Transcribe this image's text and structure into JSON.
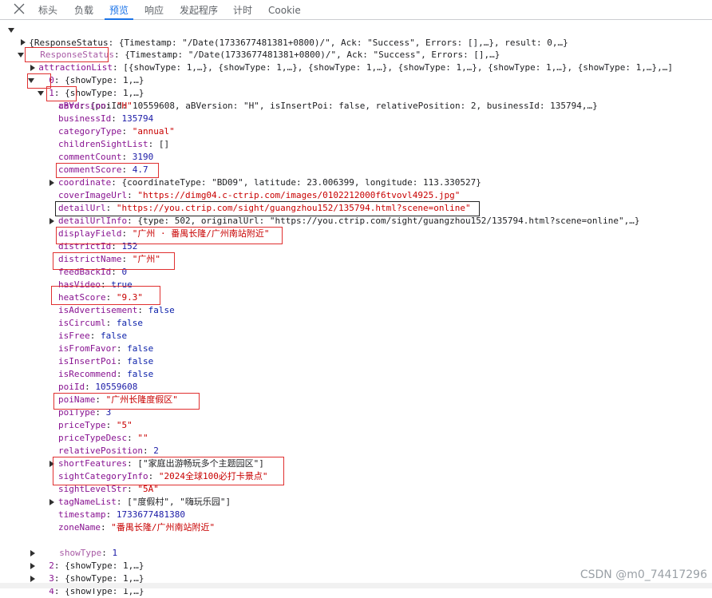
{
  "tabs": [
    {
      "label": "标头",
      "active": false
    },
    {
      "label": "负载",
      "active": false
    },
    {
      "label": "预览",
      "active": true
    },
    {
      "label": "响应",
      "active": false
    },
    {
      "label": "发起程序",
      "active": false
    },
    {
      "label": "计时",
      "active": false
    },
    {
      "label": "Cookie",
      "active": false
    }
  ],
  "tree": {
    "root_summary": "{ResponseStatus: {Timestamp: \"/Date(1733677481381+0800)/\", Ack: \"Success\", Errors: [],…}, result: 0,…}",
    "response_status": {
      "key": "ResponseStatus",
      "summary": "{Timestamp: \"/Date(1733677481381+0800)/\", Ack: \"Success\", Errors: [],…}"
    },
    "attraction_list": {
      "key": "attractionList",
      "summary": "[{showType: 1,…}, {showType: 1,…}, {showType: 1,…}, {showType: 1,…}, {showType: 1,…}, {showType: 1,…},…]"
    },
    "item0": {
      "key": "0",
      "summary": "{showType: 1,…}"
    },
    "item1": {
      "key": "1",
      "summary": "{showType: 1,…}"
    },
    "card": {
      "key": "card",
      "summary": "{poiId: 10559608, aBVersion: \"H\", isInsertPoi: false, relativePosition: 2, businessId: 135794,…}"
    },
    "fields": [
      {
        "key": "aBVersion",
        "value": "\"H\"",
        "type": "str"
      },
      {
        "key": "businessId",
        "value": "135794",
        "type": "num"
      },
      {
        "key": "categoryType",
        "value": "\"annual\"",
        "type": "str"
      },
      {
        "key": "childrenSightList",
        "value": "[]",
        "type": "plain"
      },
      {
        "key": "commentCount",
        "value": "3190",
        "type": "num"
      },
      {
        "key": "commentScore",
        "value": "4.7",
        "type": "num"
      },
      {
        "key": "coordinate",
        "value": "{coordinateType: \"BD09\", latitude: 23.006399, longitude: 113.330527}",
        "type": "plain",
        "expandable": true
      },
      {
        "key": "coverImageUrl",
        "value": "\"https://dimg04.c-ctrip.com/images/0102212000f6tvovl4925.jpg\"",
        "type": "str"
      },
      {
        "key": "detailUrl",
        "value": "\"https://you.ctrip.com/sight/guangzhou152/135794.html?scene=online\"",
        "type": "str"
      },
      {
        "key": "detailUrlInfo",
        "value": "{type: 502, originalUrl: \"https://you.ctrip.com/sight/guangzhou152/135794.html?scene=online\",…}",
        "type": "plain",
        "expandable": true
      },
      {
        "key": "displayField",
        "value": "\"广州 · 番禺长隆/广州南站附近\"",
        "type": "str"
      },
      {
        "key": "districtId",
        "value": "152",
        "type": "num"
      },
      {
        "key": "districtName",
        "value": "\"广州\"",
        "type": "str"
      },
      {
        "key": "feedBackId",
        "value": "0",
        "type": "num"
      },
      {
        "key": "hasVideo",
        "value": "true",
        "type": "bool"
      },
      {
        "key": "heatScore",
        "value": "\"9.3\"",
        "type": "str"
      },
      {
        "key": "isAdvertisement",
        "value": "false",
        "type": "bool"
      },
      {
        "key": "isCircuml",
        "value": "false",
        "type": "bool"
      },
      {
        "key": "isFree",
        "value": "false",
        "type": "bool"
      },
      {
        "key": "isFromFavor",
        "value": "false",
        "type": "bool"
      },
      {
        "key": "isInsertPoi",
        "value": "false",
        "type": "bool"
      },
      {
        "key": "isRecommend",
        "value": "false",
        "type": "bool"
      },
      {
        "key": "poiId",
        "value": "10559608",
        "type": "num"
      },
      {
        "key": "poiName",
        "value": "\"广州长隆度假区\"",
        "type": "str"
      },
      {
        "key": "poiType",
        "value": "3",
        "type": "num"
      },
      {
        "key": "priceType",
        "value": "\"5\"",
        "type": "str"
      },
      {
        "key": "priceTypeDesc",
        "value": "\"\"",
        "type": "str"
      },
      {
        "key": "relativePosition",
        "value": "2",
        "type": "num"
      },
      {
        "key": "shortFeatures",
        "value": "[\"家庭出游畅玩多个主题园区\"]",
        "type": "plain",
        "expandable": true
      },
      {
        "key": "sightCategoryInfo",
        "value": "\"2024全球100必打卡景点\"",
        "type": "str"
      },
      {
        "key": "sightLevelStr",
        "value": "\"5A\"",
        "type": "str"
      },
      {
        "key": "tagNameList",
        "value": "[\"度假村\", \"嗨玩乐园\"]",
        "type": "plain",
        "expandable": true
      },
      {
        "key": "timestamp",
        "value": "1733677481380",
        "type": "num"
      },
      {
        "key": "zoneName",
        "value": "\"番禺长隆/广州南站附近\"",
        "type": "str"
      }
    ],
    "show_type": {
      "key": "showType",
      "value": "1"
    },
    "item2": {
      "key": "2",
      "summary": "{showType: 1,…}"
    },
    "item3": {
      "key": "3",
      "summary": "{showType: 1,…}"
    },
    "item4": {
      "key": "4",
      "summary": "{showType: 1,…}"
    }
  },
  "watermark": "CSDN @m0_74417296",
  "colors": {
    "key": "#881391",
    "string": "#c80000",
    "number": "#1a1aa6",
    "annotation_box": "#e03030",
    "active_tab": "#1a73e8"
  }
}
